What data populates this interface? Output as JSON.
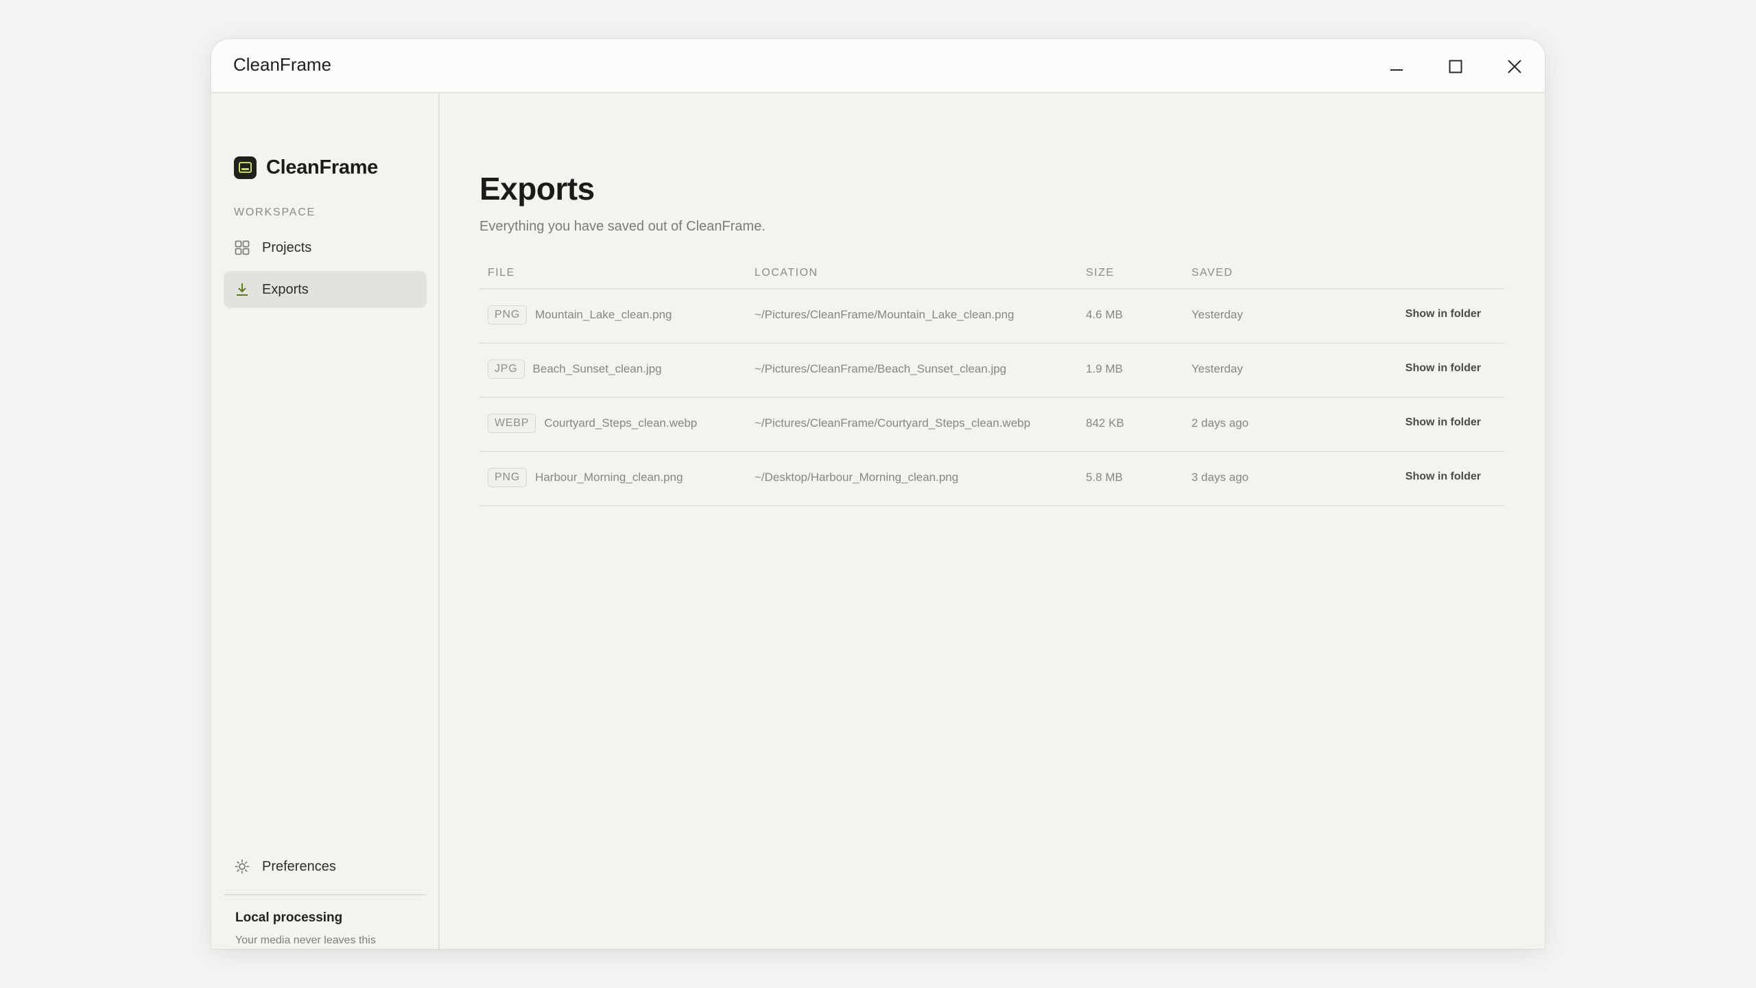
{
  "window": {
    "title": "CleanFrame"
  },
  "sidebar": {
    "brand": "CleanFrame",
    "section_label": "WORKSPACE",
    "items": [
      {
        "label": "Projects",
        "icon": "grid-icon"
      },
      {
        "label": "Exports",
        "icon": "download-icon",
        "active": true
      }
    ],
    "preferences_label": "Preferences",
    "footer": {
      "title": "Local processing",
      "description": "Your media never leaves this computer."
    }
  },
  "main": {
    "title": "Exports",
    "subtitle": "Everything you have saved out of CleanFrame.",
    "columns": {
      "file": "FILE",
      "location": "LOCATION",
      "size": "SIZE",
      "saved": "SAVED"
    },
    "rows": [
      {
        "format": "PNG",
        "name": "Mountain_Lake_clean.png",
        "location": "~/Pictures/CleanFrame/Mountain_Lake_clean.png",
        "size": "4.6 MB",
        "saved": "Yesterday",
        "action": "Show in folder"
      },
      {
        "format": "JPG",
        "name": "Beach_Sunset_clean.jpg",
        "location": "~/Pictures/CleanFrame/Beach_Sunset_clean.jpg",
        "size": "1.9 MB",
        "saved": "Yesterday",
        "action": "Show in folder"
      },
      {
        "format": "WEBP",
        "name": "Courtyard_Steps_clean.webp",
        "location": "~/Pictures/CleanFrame/Courtyard_Steps_clean.webp",
        "size": "842 KB",
        "saved": "2 days ago",
        "action": "Show in folder"
      },
      {
        "format": "PNG",
        "name": "Harbour_Morning_clean.png",
        "location": "~/Desktop/Harbour_Morning_clean.png",
        "size": "5.8 MB",
        "saved": "3 days ago",
        "action": "Show in folder"
      }
    ]
  },
  "colors": {
    "accent": "#c6dc5a",
    "background": "#f4f3ef",
    "active_nav": "#e3e3dd"
  }
}
